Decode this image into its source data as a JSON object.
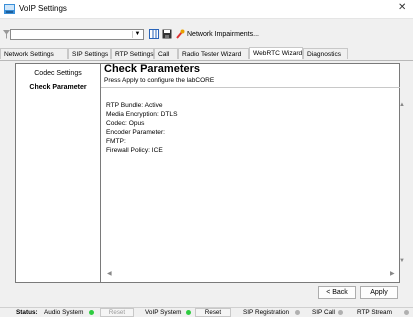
{
  "window": {
    "title": "VoIP Settings",
    "close_glyph": "✕"
  },
  "toolbar": {
    "combo_value": "",
    "network_impairments_label": "Network Impairments..."
  },
  "tabs": [
    {
      "label": "Network Settings",
      "active": false
    },
    {
      "label": "SIP Settings",
      "active": false
    },
    {
      "label": "RTP Settings",
      "active": false
    },
    {
      "label": "Call",
      "active": false
    },
    {
      "label": "Radio Tester Wizard",
      "active": false
    },
    {
      "label": "WebRTC Wizard",
      "active": true
    },
    {
      "label": "Diagnostics",
      "active": false
    }
  ],
  "nav": {
    "items": [
      {
        "label": "Codec Settings",
        "selected": false
      },
      {
        "label": "Check Parameter",
        "selected": true
      }
    ]
  },
  "header": {
    "title": "Check Parameters",
    "subtitle": "Press Apply to configure the labCORE"
  },
  "content": {
    "lines": [
      "RTP Bundle: Active",
      "Media Encryption: DTLS",
      "Codec: Opus",
      "Encoder Parameter:",
      "FMTP:",
      "Firewall Policy: ICE"
    ]
  },
  "buttons": {
    "back": "< Back",
    "apply": "Apply"
  },
  "status": {
    "label": "Status:",
    "audio_system": "Audio System",
    "audio_reset": "Reset",
    "voip_system": "VoIP System",
    "voip_reset": "Reset",
    "sip_registration": "SIP Registration",
    "sip_call": "SIP Call",
    "rtp_stream": "RTP Stream",
    "colors": {
      "ok": "#2ecc40",
      "idle": "#b0b0b0"
    }
  }
}
